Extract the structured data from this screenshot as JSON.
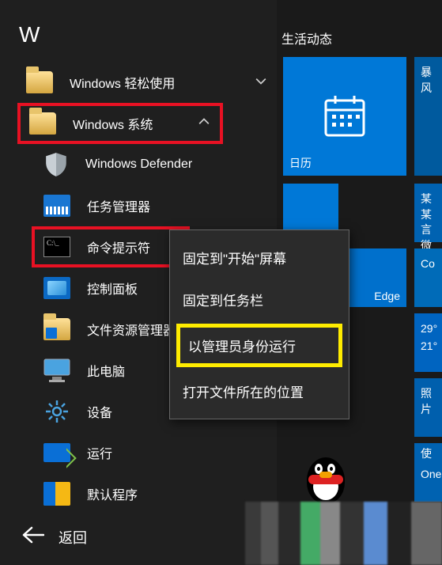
{
  "letter_header": "W",
  "tiles_header": "生活动态",
  "apps": {
    "easy": {
      "label": "Windows 轻松使用"
    },
    "system": {
      "label": "Windows 系统"
    },
    "defender": {
      "label": "Windows Defender"
    },
    "taskmgr": {
      "label": "任务管理器"
    },
    "cmd": {
      "label": "命令提示符"
    },
    "control": {
      "label": "控制面板"
    },
    "explorer": {
      "label": "文件资源管理器"
    },
    "thispc": {
      "label": "此电脑"
    },
    "settings": {
      "label": "设备"
    },
    "run": {
      "label": "运行"
    },
    "default": {
      "label": "默认程序"
    }
  },
  "back_label": "返回",
  "context_menu": {
    "pin_start": "固定到\"开始\"屏幕",
    "pin_taskbar": "固定到任务栏",
    "run_admin": "以管理员身份运行",
    "open_location": "打开文件所在的位置"
  },
  "tiles": {
    "calendar": "日历",
    "baofeng": "暴风",
    "some": "某某\n言微",
    "edge": "Edge",
    "co": "Co",
    "temp_hi": "29°",
    "temp_lo": "21°",
    "photos": "照片",
    "use": "使",
    "one": "One"
  }
}
